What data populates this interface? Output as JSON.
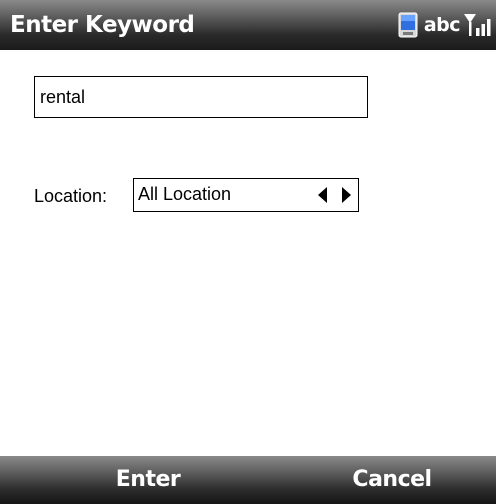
{
  "titlebar": {
    "title": "Enter Keyword",
    "input_mode": "abc",
    "icons": [
      "device-icon",
      "signal-strength-icon"
    ]
  },
  "form": {
    "keyword_value": "rental",
    "location_label": "Location:",
    "location_value": "All Location"
  },
  "softkeys": {
    "left_label": "Enter",
    "right_label": "Cancel"
  },
  "colors": {
    "bar_dark": "#1a1a1a",
    "bar_light": "#8a8a8a",
    "text_on_bar": "#ffffff",
    "device_icon_blue": "#3b7be8"
  }
}
